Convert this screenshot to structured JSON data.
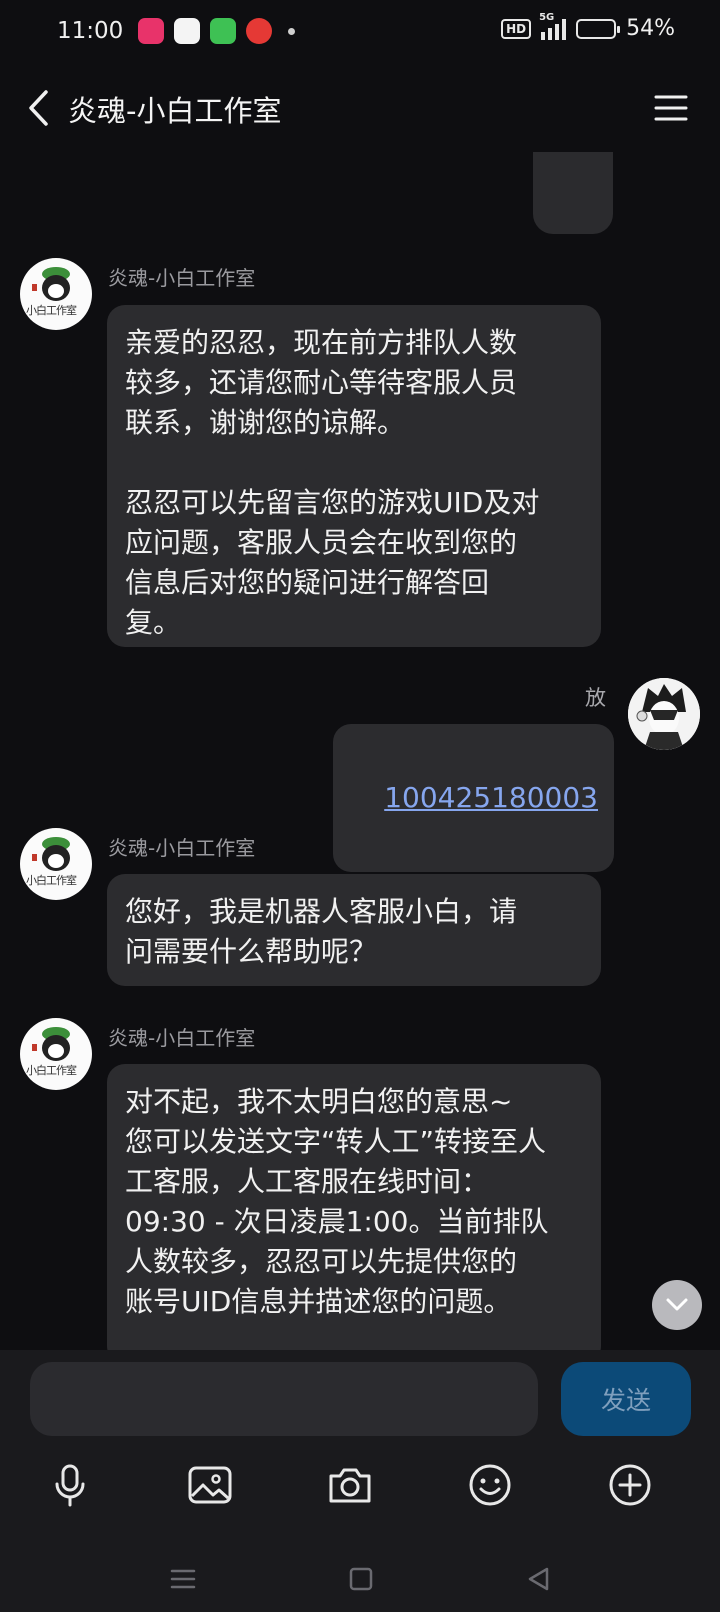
{
  "status_bar": {
    "time": "11:00",
    "network": "5G",
    "hd_label": "HD",
    "battery_percent": "54%",
    "battery_level": 0.54
  },
  "header": {
    "title": "炎魂-小白工作室"
  },
  "messages": [
    {
      "sender": "炎魂-小白工作室",
      "avatar_text": "小白工作室",
      "text": "亲爱的忍忍，现在前方排队人数\n较多，还请您耐心等待客服人员\n联系，谢谢您的谅解。\n\n忍忍可以先留言您的游戏UID及对\n应问题，客服人员会在收到您的\n信息后对您的疑问进行解答回\n复。"
    },
    {
      "sender": "放",
      "text": "100425180003"
    },
    {
      "sender": "炎魂-小白工作室",
      "avatar_text": "小白工作室",
      "text": "您好，我是机器人客服小白，请\n问需要什么帮助呢？"
    },
    {
      "sender": "炎魂-小白工作室",
      "avatar_text": "小白工作室",
      "text": "对不起，我不太明白您的意思~\n您可以发送文字“转人工”转接至人\n工客服，人工客服在线时间：\n09:30 - 次日凌晨1:00。当前排队\n人数较多，忍忍可以先提供您的\n账号UID信息并描述您的问题。"
    }
  ],
  "input": {
    "placeholder": "",
    "send_label": "发送"
  },
  "toolbar_icons": [
    "microphone-icon",
    "image-icon",
    "camera-icon",
    "emoji-icon",
    "plus-icon"
  ],
  "colors": {
    "background": "#0e0e11",
    "bubble": "#2c2c2f",
    "link": "#86a6ee",
    "send_button": "#0c4a78"
  }
}
